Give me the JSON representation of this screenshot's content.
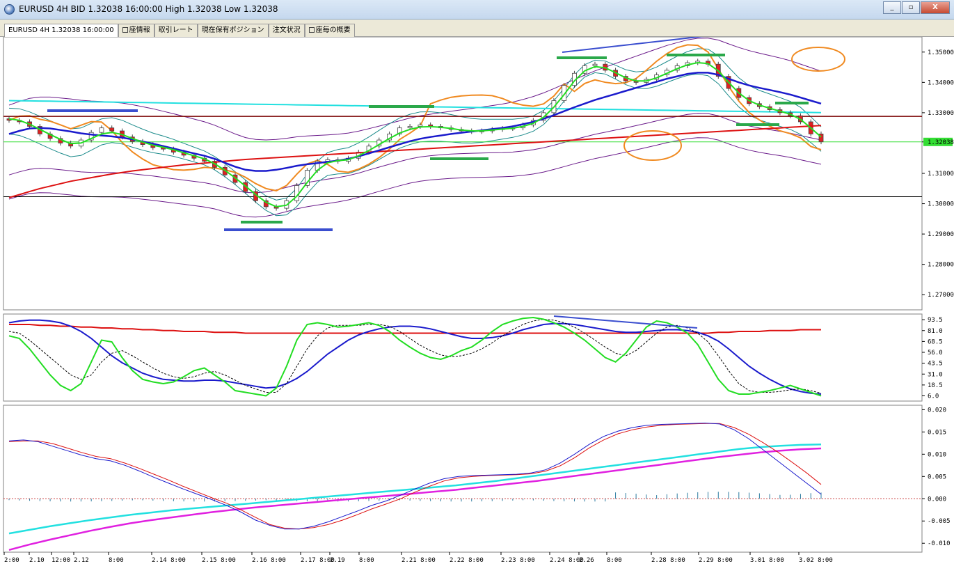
{
  "window": {
    "title": "EURUSD 4H BID 1.32038 16:00:00 High 1.32038 Low 1.32038",
    "minimize_label": "_",
    "restore_label": "▫",
    "close_label": "X"
  },
  "tabs": [
    {
      "label": "EURUSD 4H 1.32038 16:00:00",
      "active": true,
      "box": false
    },
    {
      "label": "座情報",
      "active": false,
      "box": true
    },
    {
      "label": "取引レート",
      "active": false,
      "box": false
    },
    {
      "label": "現在保有ポジション",
      "active": false,
      "box": false
    },
    {
      "label": "注文状況",
      "active": false,
      "box": false
    },
    {
      "label": "座毎の概要",
      "active": false,
      "box": true
    }
  ],
  "price_axis": {
    "labels": [
      "1.35000",
      "1.34000",
      "1.33000",
      "1.32038",
      "1.31000",
      "1.30000",
      "1.29000",
      "1.28000",
      "1.27000"
    ],
    "current_price": "1.32038"
  },
  "stoch_axis": {
    "labels": [
      "93.5",
      "81.0",
      "68.5",
      "56.0",
      "43.5",
      "31.0",
      "18.5",
      "6.0"
    ]
  },
  "macd_axis": {
    "labels": [
      "0.020",
      "0.015",
      "0.010",
      "0.005",
      "0.000",
      "-0.005",
      "-0.010"
    ]
  },
  "time_axis": {
    "labels": [
      "2:00",
      "2.10",
      "12:00",
      "2.12",
      "8:00",
      "2.14 8:00",
      "2.15 8:00",
      "2.16 8:00",
      "2.17 8:00",
      "2.19",
      "8:00",
      "2.21 8:00",
      "2.22 8:00",
      "2.23 8:00",
      "2.24 8:00",
      "2.26",
      "8:00",
      "2.28 8:00",
      "2.29 8:00",
      "3.01 8:00",
      "3.02 8:00"
    ]
  },
  "colors": {
    "ma_fast": "#22dd22",
    "ma_mid": "#1a1acc",
    "ma_slow": "#dd1111",
    "bollinger": "#1a8a8a",
    "envelope": "#6a1a8a",
    "cyan_line": "#22e0e0",
    "orange_line": "#f08a20",
    "support_line": "#7a0000",
    "current_price_line": "#33dd33",
    "annotation_green": "#2aa84a",
    "annotation_blue": "#3a4ecf",
    "annotation_circle": "#f08a20",
    "macd_main": "#1a1acc",
    "macd_signal": "#dd1111",
    "macd_cyan": "#22e0e0",
    "macd_magenta": "#e020e0",
    "candle_up": "#ffffff",
    "candle_down": "#dd2222"
  },
  "chart_data": [
    {
      "type": "line",
      "panel": "price",
      "x_axis": "time (4H bars)",
      "ylim": [
        1.265,
        1.355
      ],
      "series": [
        {
          "key": "close",
          "values": [
            1.3275,
            1.327,
            1.3255,
            1.323,
            1.3215,
            1.32,
            1.319,
            1.321,
            1.3235,
            1.325,
            1.324,
            1.322,
            1.3205,
            1.3195,
            1.3185,
            1.318,
            1.317,
            1.316,
            1.315,
            1.314,
            1.312,
            1.3095,
            1.307,
            1.304,
            1.301,
            1.299,
            1.2985,
            1.301,
            1.306,
            1.311,
            1.314,
            1.3145,
            1.314,
            1.315,
            1.317,
            1.319,
            1.321,
            1.323,
            1.325,
            1.3255,
            1.326,
            1.3255,
            1.325,
            1.3245,
            1.324,
            1.3238,
            1.324,
            1.3245,
            1.3248,
            1.325,
            1.326,
            1.3275,
            1.33,
            1.334,
            1.339,
            1.343,
            1.3455,
            1.346,
            1.344,
            1.342,
            1.3405,
            1.34,
            1.341,
            1.3425,
            1.344,
            1.3455,
            1.3465,
            1.347,
            1.346,
            1.342,
            1.338,
            1.335,
            1.333,
            1.332,
            1.331,
            1.33,
            1.329,
            1.327,
            1.323,
            1.3204
          ]
        },
        {
          "key": "ma_fast",
          "values": [
            1.328,
            1.3275,
            1.3262,
            1.3245,
            1.3228,
            1.3212,
            1.3198,
            1.32,
            1.3215,
            1.323,
            1.3235,
            1.3228,
            1.3215,
            1.3203,
            1.3193,
            1.3186,
            1.3178,
            1.3168,
            1.3158,
            1.3148,
            1.3132,
            1.311,
            1.3085,
            1.3058,
            1.303,
            1.3005,
            1.299,
            1.2995,
            1.3025,
            1.307,
            1.311,
            1.3135,
            1.3142,
            1.3145,
            1.3158,
            1.3175,
            1.3195,
            1.3215,
            1.3233,
            1.3245,
            1.3253,
            1.3254,
            1.3252,
            1.3248,
            1.3243,
            1.324,
            1.324,
            1.3243,
            1.3246,
            1.3249,
            1.3255,
            1.3265,
            1.3285,
            1.3318,
            1.336,
            1.3405,
            1.3438,
            1.3452,
            1.3448,
            1.3432,
            1.3415,
            1.3405,
            1.3405,
            1.3415,
            1.343,
            1.3445,
            1.3458,
            1.3465,
            1.3462,
            1.3438,
            1.34,
            1.3365,
            1.334,
            1.3325,
            1.3315,
            1.3305,
            1.3295,
            1.3278,
            1.325,
            1.322
          ]
        },
        {
          "key": "ma_mid",
          "values": [
            1.323,
            1.324,
            1.3248,
            1.325,
            1.3248,
            1.3243,
            1.3238,
            1.3232,
            1.3228,
            1.3225,
            1.3222,
            1.3218,
            1.3212,
            1.3205,
            1.3198,
            1.319,
            1.3182,
            1.3174,
            1.3166,
            1.3158,
            1.3148,
            1.3135,
            1.3122,
            1.3112,
            1.3108,
            1.3108,
            1.3112,
            1.3118,
            1.3125,
            1.313,
            1.3134,
            1.3138,
            1.3142,
            1.3148,
            1.3156,
            1.3166,
            1.3176,
            1.3186,
            1.3196,
            1.3206,
            1.3214,
            1.322,
            1.3225,
            1.323,
            1.3234,
            1.3238,
            1.3242,
            1.3246,
            1.325,
            1.3255,
            1.3262,
            1.327,
            1.328,
            1.3292,
            1.3305,
            1.3318,
            1.333,
            1.3342,
            1.3352,
            1.3362,
            1.3372,
            1.3382,
            1.3392,
            1.3402,
            1.3412,
            1.342,
            1.3428,
            1.3432,
            1.3432,
            1.3425,
            1.3412,
            1.34,
            1.339,
            1.3382,
            1.3375,
            1.3368,
            1.336,
            1.335,
            1.334,
            1.333
          ]
        },
        {
          "key": "ma_slow",
          "values": [
            1.302,
            1.303,
            1.304,
            1.305,
            1.3058,
            1.3066,
            1.3074,
            1.308,
            1.3086,
            1.3092,
            1.3098,
            1.3103,
            1.3108,
            1.3112,
            1.3116,
            1.312,
            1.3124,
            1.3128,
            1.3131,
            1.3134,
            1.3137,
            1.314,
            1.3143,
            1.3146,
            1.3148,
            1.315,
            1.3152,
            1.3154,
            1.3156,
            1.3158,
            1.316,
            1.3162,
            1.3164,
            1.3166,
            1.3168,
            1.317,
            1.3172,
            1.3174,
            1.3176,
            1.3178,
            1.318,
            1.3182,
            1.3184,
            1.3186,
            1.3188,
            1.319,
            1.3192,
            1.3194,
            1.3196,
            1.3198,
            1.32,
            1.3202,
            1.3204,
            1.3206,
            1.3208,
            1.321,
            1.3212,
            1.3214,
            1.3216,
            1.3218,
            1.322,
            1.3222,
            1.3224,
            1.3226,
            1.3228,
            1.323,
            1.3232,
            1.3234,
            1.3236,
            1.3238,
            1.324,
            1.3242,
            1.3244,
            1.3246,
            1.3248,
            1.325,
            1.3252,
            1.3254,
            1.3256,
            1.3258
          ]
        }
      ]
    },
    {
      "type": "line",
      "panel": "stochastic",
      "ylim": [
        0,
        100
      ],
      "series": [
        {
          "key": "stoch_k",
          "values": [
            75,
            72,
            60,
            45,
            30,
            18,
            12,
            20,
            45,
            70,
            68,
            50,
            35,
            25,
            22,
            20,
            22,
            28,
            35,
            38,
            30,
            22,
            12,
            10,
            8,
            6,
            15,
            40,
            70,
            88,
            90,
            88,
            85,
            86,
            88,
            90,
            87,
            80,
            70,
            62,
            55,
            50,
            48,
            52,
            58,
            62,
            70,
            80,
            88,
            92,
            95,
            96,
            94,
            90,
            85,
            78,
            70,
            60,
            50,
            45,
            55,
            70,
            85,
            92,
            90,
            85,
            78,
            65,
            45,
            25,
            12,
            8,
            8,
            10,
            12,
            15,
            18,
            14,
            10,
            6
          ]
        },
        {
          "key": "stoch_signal",
          "values": [
            80,
            78,
            70,
            60,
            50,
            40,
            30,
            25,
            30,
            45,
            55,
            58,
            52,
            45,
            38,
            32,
            28,
            26,
            28,
            32,
            34,
            30,
            24,
            18,
            14,
            10,
            10,
            20,
            40,
            60,
            75,
            84,
            87,
            87,
            87,
            88,
            88,
            86,
            80,
            72,
            64,
            58,
            53,
            51,
            52,
            55,
            60,
            67,
            75,
            82,
            88,
            92,
            94,
            93,
            90,
            85,
            78,
            70,
            62,
            55,
            52,
            58,
            68,
            78,
            85,
            87,
            84,
            78,
            68,
            52,
            35,
            20,
            12,
            10,
            10,
            11,
            13,
            14,
            12,
            9
          ]
        },
        {
          "key": "stoch_slow",
          "values": [
            90,
            92,
            93,
            93,
            92,
            90,
            86,
            80,
            72,
            62,
            52,
            44,
            38,
            32,
            28,
            25,
            24,
            23,
            23,
            24,
            24,
            23,
            21,
            19,
            17,
            15,
            16,
            20,
            26,
            34,
            44,
            54,
            62,
            70,
            76,
            80,
            83,
            85,
            86,
            86,
            85,
            83,
            80,
            77,
            74,
            72,
            72,
            73,
            75,
            78,
            82,
            85,
            88,
            89,
            89,
            88,
            86,
            84,
            82,
            80,
            79,
            79,
            80,
            81,
            82,
            82,
            81,
            79,
            75,
            69,
            60,
            50,
            40,
            32,
            25,
            19,
            14,
            11,
            9,
            8
          ]
        },
        {
          "key": "stoch_long",
          "values": [
            88,
            88,
            88,
            87,
            87,
            86,
            86,
            85,
            85,
            84,
            84,
            83,
            83,
            82,
            82,
            81,
            81,
            80,
            80,
            80,
            79,
            79,
            79,
            78,
            78,
            78,
            78,
            78,
            78,
            78,
            78,
            78,
            78,
            78,
            78,
            78,
            78,
            78,
            78,
            78,
            78,
            78,
            78,
            78,
            78,
            78,
            78,
            78,
            78,
            78,
            78,
            78,
            78,
            78,
            78,
            78,
            78,
            78,
            78,
            78,
            78,
            78,
            78,
            78,
            78,
            78,
            78,
            78,
            78,
            79,
            79,
            80,
            80,
            80,
            81,
            81,
            81,
            82,
            82,
            82
          ]
        }
      ]
    },
    {
      "type": "line",
      "panel": "macd",
      "ylim": [
        -0.012,
        0.021
      ],
      "series": [
        {
          "key": "macd_main",
          "values": [
            0.013,
            0.0132,
            0.0128,
            0.0118,
            0.0108,
            0.0098,
            0.009,
            0.0085,
            0.0075,
            0.0062,
            0.0048,
            0.0035,
            0.0022,
            0.001,
            -0.0002,
            -0.0015,
            -0.003,
            -0.0048,
            -0.006,
            -0.0068,
            -0.0068,
            -0.0062,
            -0.0052,
            -0.004,
            -0.0028,
            -0.0015,
            -0.0005,
            0.0008,
            0.0022,
            0.0035,
            0.0045,
            0.005,
            0.0052,
            0.0053,
            0.0054,
            0.0055,
            0.0058,
            0.0065,
            0.008,
            0.01,
            0.0122,
            0.014,
            0.0152,
            0.016,
            0.0165,
            0.0167,
            0.0168,
            0.0169,
            0.017,
            0.0168,
            0.0155,
            0.0135,
            0.011,
            0.0085,
            0.006,
            0.0035,
            0.001
          ]
        },
        {
          "key": "macd_signal",
          "values": [
            0.0128,
            0.013,
            0.013,
            0.0124,
            0.0114,
            0.0104,
            0.0095,
            0.009,
            0.008,
            0.0068,
            0.0055,
            0.0042,
            0.0028,
            0.0015,
            0.0002,
            -0.001,
            -0.0025,
            -0.0042,
            -0.0058,
            -0.0066,
            -0.0068,
            -0.0065,
            -0.0058,
            -0.0048,
            -0.0036,
            -0.0023,
            -0.0012,
            0.0,
            0.0015,
            0.0028,
            0.004,
            0.0047,
            0.005,
            0.0052,
            0.0053,
            0.0054,
            0.0056,
            0.0062,
            0.0074,
            0.0092,
            0.0114,
            0.0132,
            0.0146,
            0.0155,
            0.0161,
            0.0165,
            0.0167,
            0.0168,
            0.0169,
            0.0169,
            0.016,
            0.0145,
            0.0126,
            0.0105,
            0.0082,
            0.0058,
            0.0032
          ]
        },
        {
          "key": "macd_cyan",
          "values": [
            -0.0078,
            -0.007,
            -0.0062,
            -0.0055,
            -0.0048,
            -0.0042,
            -0.0036,
            -0.0031,
            -0.0026,
            -0.0022,
            -0.0018,
            -0.0014,
            -0.001,
            -0.0006,
            -0.0002,
            0.0002,
            0.0006,
            0.001,
            0.0014,
            0.0018,
            0.0022,
            0.0026,
            0.003,
            0.0035,
            0.004,
            0.0046,
            0.0052,
            0.0058,
            0.0064,
            0.007,
            0.0076,
            0.0082,
            0.0088,
            0.0094,
            0.01,
            0.0106,
            0.0112,
            0.0116,
            0.0119,
            0.0121,
            0.0122
          ]
        },
        {
          "key": "macd_magenta",
          "values": [
            -0.0115,
            -0.0103,
            -0.0092,
            -0.0082,
            -0.0072,
            -0.0063,
            -0.0055,
            -0.0048,
            -0.0042,
            -0.0036,
            -0.003,
            -0.0025,
            -0.002,
            -0.0016,
            -0.0012,
            -0.0008,
            -0.0004,
            0.0,
            0.0004,
            0.0008,
            0.0012,
            0.0016,
            0.002,
            0.0025,
            0.003,
            0.0035,
            0.004,
            0.0046,
            0.0052,
            0.0058,
            0.0064,
            0.007,
            0.0076,
            0.0082,
            0.0088,
            0.0094,
            0.0099,
            0.0104,
            0.0108,
            0.0111,
            0.0113
          ]
        }
      ]
    }
  ]
}
